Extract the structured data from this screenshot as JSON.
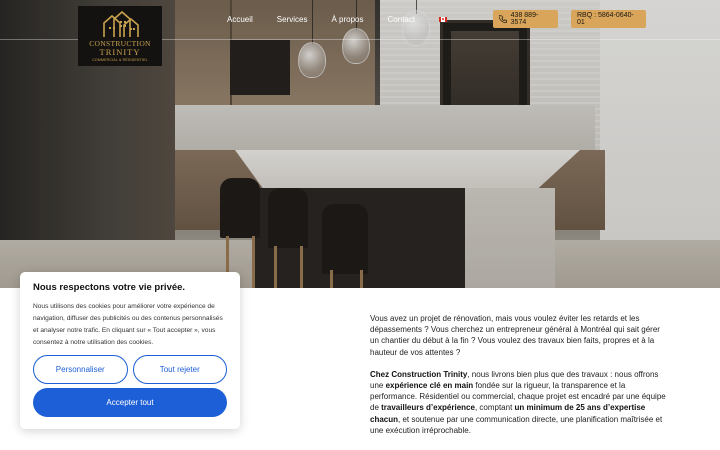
{
  "brand": {
    "name_line1": "CONSTRUCTION",
    "name_line2": "TRINITY",
    "tagline": "COMMERCIAL & RÉSIDENTIEL",
    "gold": "#c9a24f"
  },
  "nav": {
    "items": [
      {
        "label": "Accueil"
      },
      {
        "label": "Services"
      },
      {
        "label": "À propos"
      },
      {
        "label": "Contact"
      }
    ],
    "language_icon": "canada-flag-icon"
  },
  "header_buttons": {
    "phone": {
      "label": "438 889-3574",
      "icon": "phone-icon"
    },
    "rbq": {
      "label": "RBQ : 5864-0640-01"
    },
    "accent": "#d9a55a"
  },
  "intro": {
    "p1": "Vous avez un projet de rénovation, mais vous voulez éviter les retards et les dépassements ? Vous cherchez un entrepreneur général à Montréal qui sait gérer un chantier du début à la fin ? Vous voulez des travaux bien faits, propres et à la hauteur de vos attentes ?",
    "p2": {
      "s1": "Chez Construction Trinity",
      "s2": ", nous livrons bien plus que des travaux : nous offrons une ",
      "s3": "expérience clé en main",
      "s4": " fondée sur la rigueur, la transparence et la performance. Résidentiel ou commercial, chaque projet est encadré par une équipe de ",
      "s5": "travailleurs d’expérience",
      "s6": ", comptant ",
      "s7": "un minimum de 25 ans d’expertise chacun",
      "s8": ", et soutenue par une communication directe, une planification maîtrisée et une exécution irréprochable."
    }
  },
  "cookie": {
    "title": "Nous respectons votre vie privée.",
    "text": "Nous utilisons des cookies pour améliorer votre expérience de navigation, diffuser des publicités ou des contenus personnalisés et analyser notre trafic. En cliquant sur « Tout accepter », vous consentez à notre utilisation des cookies.",
    "customize": "Personnaliser",
    "reject": "Tout rejeter",
    "accept": "Accepter tout",
    "accent": "#1d5fd6"
  }
}
